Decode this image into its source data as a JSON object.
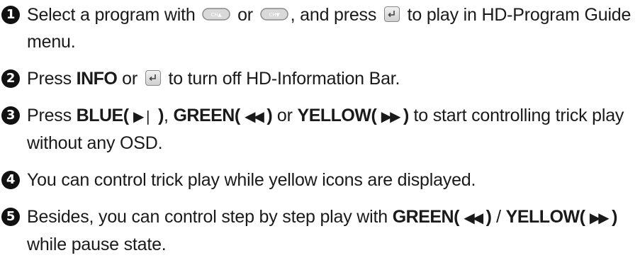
{
  "steps": [
    {
      "num": "1",
      "t1": "Select a program with",
      "t2": "or",
      "t3": ", and press",
      "t4": "to play in HD-Program Guide menu.",
      "ch_up_icon_label": "CH▲",
      "ch_down_icon_label": "CH▼"
    },
    {
      "num": "2",
      "t1": "Press",
      "k1": "INFO",
      "t2": "or",
      "t3": "to turn off HD-Information Bar."
    },
    {
      "num": "3",
      "t1": "Press",
      "k1": "BLUE(",
      "g1": "▶",
      "g1b": "❘",
      "k1b": ")",
      "t2": ",",
      "k2": "GREEN(",
      "g2": "◀◀",
      "k2b": ")",
      "t3": "or",
      "k3": "YELLOW(",
      "g3": "▶▶",
      "k3b": ")",
      "t4": "to start controlling trick play without any OSD."
    },
    {
      "num": "4",
      "t1": "You can control trick play while yellow icons are displayed."
    },
    {
      "num": "5",
      "t1": "Besides, you can control step by step play with",
      "k1": "GREEN(",
      "g1": "◀◀",
      "k1b": ")",
      "t2": "/",
      "k2": "YELLOW(",
      "g2": "▶▶",
      "k2b": ")",
      "t3": "while pause state."
    }
  ],
  "icons": {
    "number_badge_color": "#111111",
    "ch_icon_color": "#9a9a9a",
    "enter_icon": "enter-key-icon"
  }
}
